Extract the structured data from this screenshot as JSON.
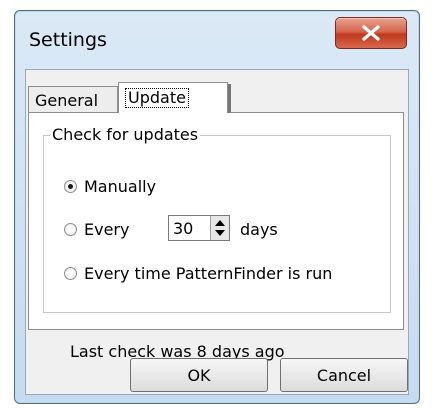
{
  "window": {
    "title": "Settings"
  },
  "tabs": [
    {
      "label": "General"
    },
    {
      "label": "Update"
    }
  ],
  "update": {
    "group_label": "Check for updates",
    "options": [
      {
        "label": "Manually",
        "selected": true
      },
      {
        "label": "Every",
        "selected": false
      },
      {
        "label": "Every time PatternFinder is run",
        "selected": false
      }
    ],
    "interval_value": "30",
    "interval_unit": "days",
    "last_check": "Last check was 8 days ago"
  },
  "buttons": {
    "ok": "OK",
    "cancel": "Cancel"
  },
  "icons": {
    "close": "close-icon",
    "spinner": "spinner-arrows-icon"
  }
}
